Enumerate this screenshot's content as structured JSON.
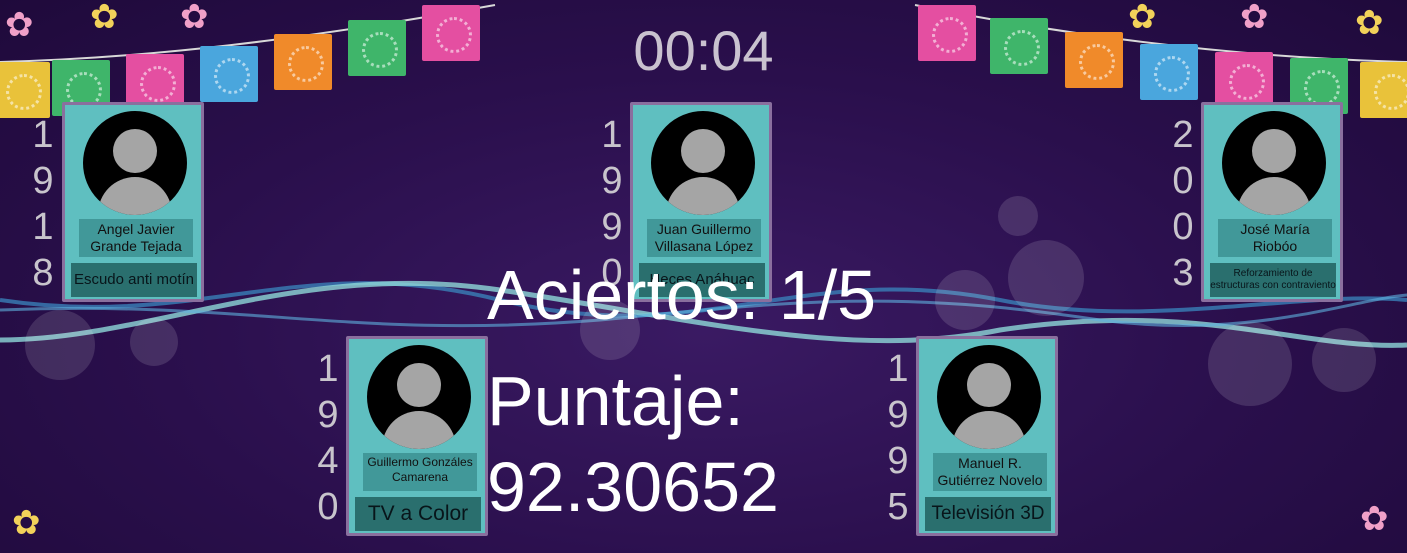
{
  "timer": "00:04",
  "results": {
    "hits_label": "Aciertos: 1/5",
    "score_label": "Puntaje:",
    "score_value": "92.30652"
  },
  "cards": [
    {
      "id": "c1",
      "year": [
        "1",
        "9",
        "1",
        "8"
      ],
      "name": "Angel Javier Grande Tejada",
      "invention": "Escudo anti motín"
    },
    {
      "id": "c2",
      "year": [
        "1",
        "9",
        "9",
        "0"
      ],
      "name": "Juan Guillermo Villasana López",
      "invention": "Heces Anáhuac"
    },
    {
      "id": "c3",
      "year": [
        "2",
        "0",
        "0",
        "3"
      ],
      "name": "José María Riobóo",
      "invention": "Reforzamiento de estructuras con contraviento"
    },
    {
      "id": "c4",
      "year": [
        "1",
        "9",
        "4",
        "0"
      ],
      "name": "Guillermo Gonzáles Camarena",
      "invention": "TV a Color"
    },
    {
      "id": "c5",
      "year": [
        "1",
        "9",
        "9",
        "5"
      ],
      "name": "Manuel R. Gutiérrez Novelo",
      "invention": "Televisión 3D"
    }
  ],
  "colors": {
    "background": "#2a0f4c",
    "card": "#5fbfc0",
    "card_border": "#8a6f9e",
    "wave_light": "#8fd8d8",
    "wave_dark": "#3a7fb8"
  },
  "decor": {
    "flag_colors": [
      "#e9c23a",
      "#3fb56a",
      "#e44fa1",
      "#4aa6dd",
      "#f08a2a",
      "#3fb56a",
      "#e44fa1"
    ],
    "flower_icon": "flower-icon"
  }
}
